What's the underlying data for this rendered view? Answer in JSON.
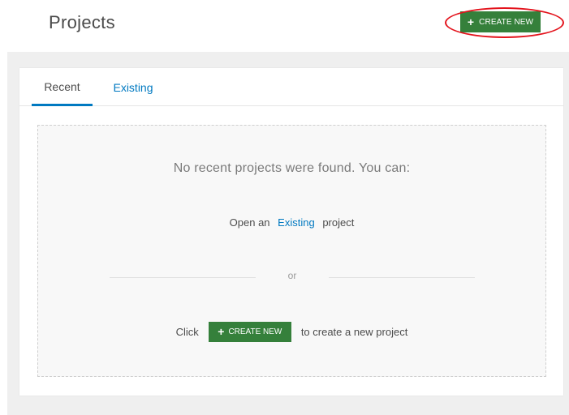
{
  "header": {
    "title": "Projects",
    "create_button": {
      "icon": "plus-icon",
      "label": "CREATE NEW"
    }
  },
  "tabs": [
    {
      "label": "Recent",
      "active": true
    },
    {
      "label": "Existing",
      "active": false
    }
  ],
  "empty_state": {
    "message": "No recent projects were found. You can:",
    "open_prefix": "Open an",
    "open_link": "Existing",
    "open_suffix": "project",
    "or_text": "or",
    "click_prefix": "Click",
    "create_button": {
      "icon": "plus-icon",
      "label": "CREATE NEW"
    },
    "click_suffix": "to create a new project"
  },
  "colors": {
    "accent_green": "#35803b",
    "link_blue": "#0079c1",
    "highlight_red": "#e3121b",
    "background_gray": "#efefef"
  }
}
